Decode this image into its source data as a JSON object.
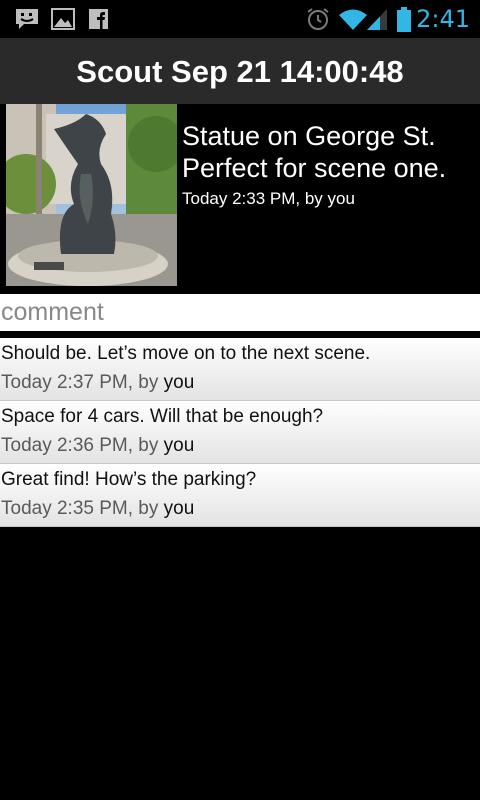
{
  "status_bar": {
    "time": "2:41",
    "icons": [
      "chat-icon",
      "gallery-icon",
      "facebook-icon",
      "alarm-icon",
      "wifi-icon",
      "signal-icon",
      "battery-icon"
    ]
  },
  "title_bar": {
    "title": "Scout Sep 21 14:00:48"
  },
  "post": {
    "image": "statue-photo",
    "title": "Statue on George St. Perfect for scene one.",
    "meta": "Today 2:33 PM, by you"
  },
  "comment_input": {
    "placeholder": "comment",
    "value": ""
  },
  "comments": [
    {
      "text": "Should be.  Let’s move on to the next scene.",
      "time": "Today 2:37 PM, by",
      "author": "you"
    },
    {
      "text": "Space for 4 cars. Will that be enough?",
      "time": "Today 2:36 PM, by",
      "author": "you"
    },
    {
      "text": "Great find!  How’s the parking?",
      "time": "Today 2:35 PM, by",
      "author": "you"
    }
  ],
  "colors": {
    "clock": "#33b5e5",
    "title_bar_bg": "#2a2a2a",
    "background": "#000000"
  }
}
